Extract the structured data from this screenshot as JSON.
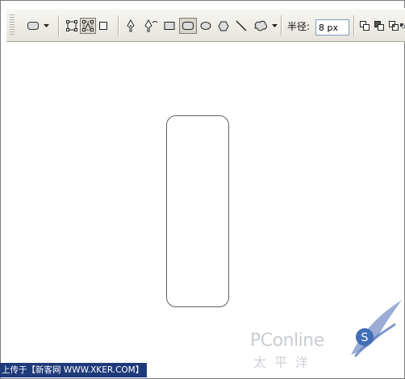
{
  "toolbar": {
    "radius_label": "半径:",
    "radius_value": "8 px"
  },
  "icons": [
    "rounded-rect-preset-icon",
    "dropdown-arrow-icon",
    "shape-layers-icon",
    "paths-icon",
    "fill-pixels-icon",
    "pen-icon",
    "freeform-pen-icon",
    "rectangle-icon",
    "rounded-rectangle-icon",
    "ellipse-icon",
    "polygon-icon",
    "line-icon",
    "custom-shape-icon",
    "add-to-shape-icon",
    "subtract-shape-icon",
    "intersect-shape-icon",
    "exclude-shape-icon"
  ],
  "caption": "上传于【新客网 WWW.XKER.COM】",
  "watermark": {
    "brand": "PConline",
    "sub": "太平洋"
  },
  "colors": {
    "toolbar_bg": "#ece9d8",
    "caption_bg": "#1f3a7a",
    "shape_stroke": "#606060"
  }
}
